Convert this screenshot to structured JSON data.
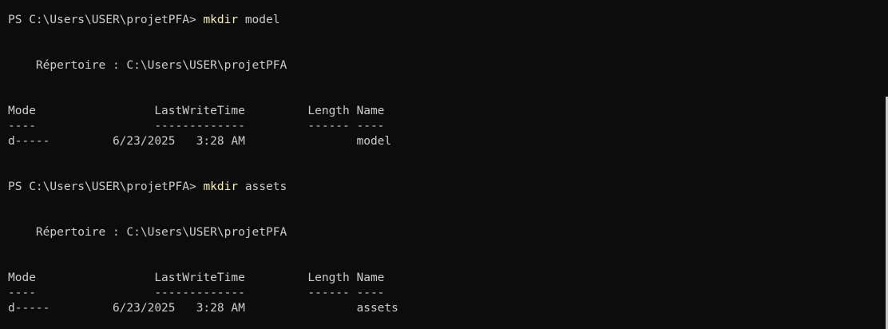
{
  "session1": {
    "prompt": "PS C:\\Users\\USER\\projetPFA> ",
    "command": "mkdir",
    "argument": " model",
    "directory_line": "    Répertoire : C:\\Users\\USER\\projetPFA",
    "header_line": "Mode                 LastWriteTime         Length Name",
    "separator_line": "----                 -------------         ------ ----",
    "entry_line": "d-----         6/23/2025   3:28 AM                model"
  },
  "session2": {
    "prompt": "PS C:\\Users\\USER\\projetPFA> ",
    "command": "mkdir",
    "argument": " assets",
    "directory_line": "    Répertoire : C:\\Users\\USER\\projetPFA",
    "header_line": "Mode                 LastWriteTime         Length Name",
    "separator_line": "----                 -------------         ------ ----",
    "entry_line": "d-----         6/23/2025   3:28 AM                assets"
  },
  "colors": {
    "background": "#0c0c0c",
    "text": "#cccccc",
    "command": "#f9f1a5"
  }
}
